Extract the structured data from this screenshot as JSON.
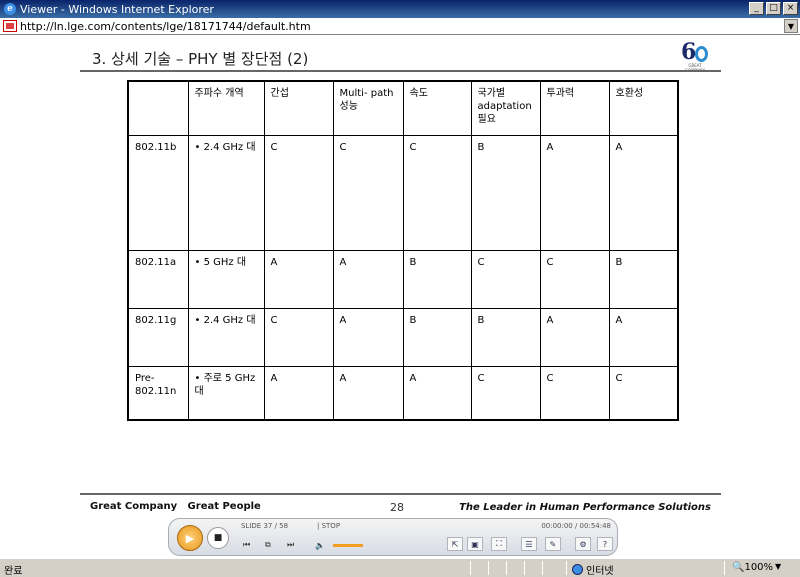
{
  "window": {
    "title": "Viewer - Windows Internet Explorer"
  },
  "address": {
    "url": "http://ln.lge.com/contents/lge/18171744/default.htm"
  },
  "slide": {
    "title": "3. 상세 기술 – PHY 별 장단점 (2)",
    "logo_tag": "GREAT COMPANY",
    "table": {
      "headers": [
        "",
        "주파수 개역",
        "간섭",
        "Multi- path 성능",
        "속도",
        "국가별 adaptation 필요",
        "투과력",
        "호환성"
      ],
      "rows": [
        [
          "802.11b",
          "• 2.4 GHz 대",
          "C",
          "C",
          "C",
          "B",
          "A",
          "A"
        ],
        [
          "802.11a",
          "• 5 GHz 대",
          "A",
          "A",
          "B",
          "C",
          "C",
          "B"
        ],
        [
          "802.11g",
          "• 2.4 GHz 대",
          "C",
          "A",
          "B",
          "B",
          "A",
          "A"
        ],
        [
          "Pre-802.11n",
          "• 주로 5 GHz 대",
          "A",
          "A",
          "A",
          "C",
          "C",
          "C"
        ]
      ]
    },
    "footer_left": "Great Company   Great People",
    "page_number": "28",
    "footer_right": "The Leader in Human Performance Solutions"
  },
  "player": {
    "slide_counter": "SLIDE 37 / 58",
    "status": "| STOP",
    "time": "00:00:00 / 00:54:48"
  },
  "statusbar": {
    "done": "완료",
    "zone": "인터넷",
    "zoom": "100%"
  }
}
